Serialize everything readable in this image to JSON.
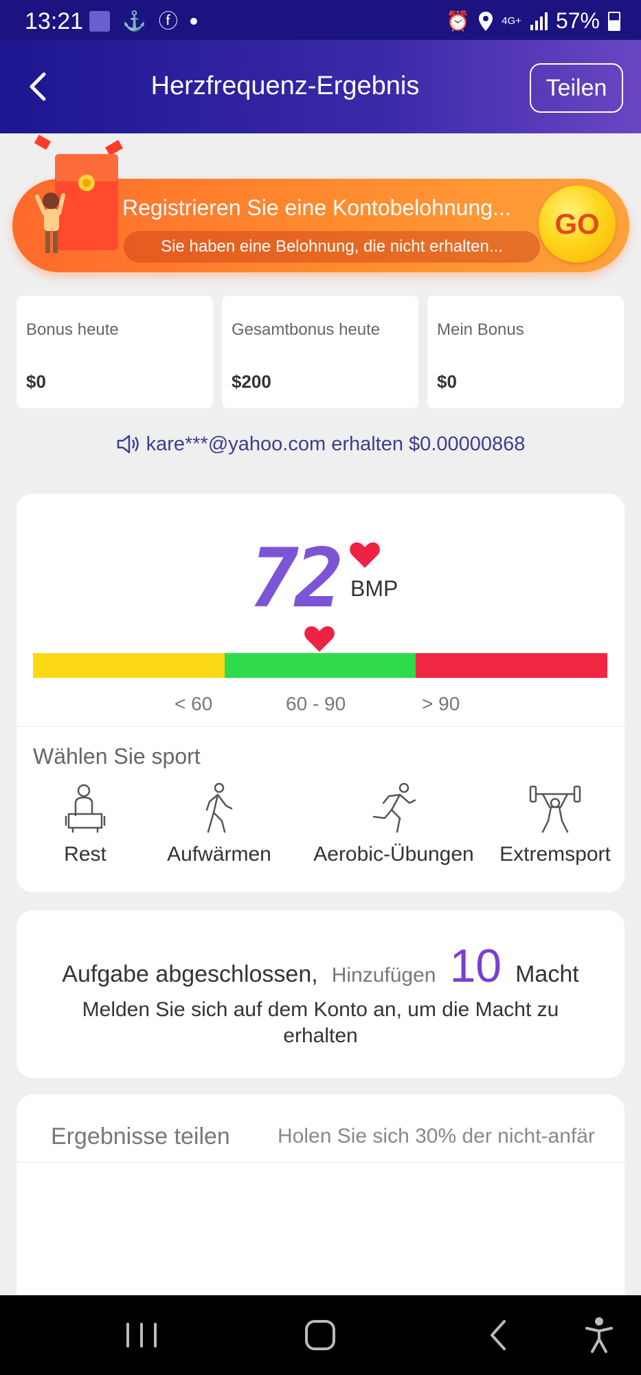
{
  "status_bar": {
    "time": "13:21",
    "network": "4G+",
    "battery": "57%"
  },
  "header": {
    "title": "Herzfrequenz-Ergebnis",
    "share_label": "Teilen"
  },
  "promo": {
    "title": "Registrieren Sie eine Kontobelohnung...",
    "subtitle": "Sie haben eine Belohnung, die nicht erhalten...",
    "go_label": "GO"
  },
  "bonus_cards": [
    {
      "label": "Bonus heute",
      "value": "$0"
    },
    {
      "label": "Gesamtbonus heute",
      "value": "$200"
    },
    {
      "label": "Mein Bonus",
      "value": "$0"
    }
  ],
  "ticker": "kare***@yahoo.com erhalten $0.00000868",
  "heart_rate": {
    "value": "72",
    "unit": "BMP",
    "ranges": [
      "< 60",
      "60 - 90",
      "> 90"
    ],
    "colors": {
      "low": "#fcd915",
      "normal": "#2edb4b",
      "high": "#f02742",
      "heart": "#ee2244"
    }
  },
  "sport": {
    "title": "Wählen Sie sport",
    "items": [
      {
        "label": "Rest",
        "icon": "rest-icon"
      },
      {
        "label": "Aufwärmen",
        "icon": "walking-icon"
      },
      {
        "label": "Aerobic-Übungen",
        "icon": "running-icon"
      },
      {
        "label": "Extremsport",
        "icon": "weightlifting-icon"
      }
    ]
  },
  "task": {
    "prefix": "Aufgabe abgeschlossen,",
    "add_label": "Hinzufügen",
    "amount": "10",
    "unit": "Macht",
    "description": "Melden Sie sich auf dem Konto an, um die Macht zu erhalten"
  },
  "share": {
    "tab1": "Ergebnisse teilen",
    "tab2": "Holen Sie sich 30% der nicht-anfär"
  },
  "navbar": {
    "icons": [
      "recent-apps-icon",
      "home-icon",
      "back-icon",
      "accessibility-icon"
    ]
  }
}
